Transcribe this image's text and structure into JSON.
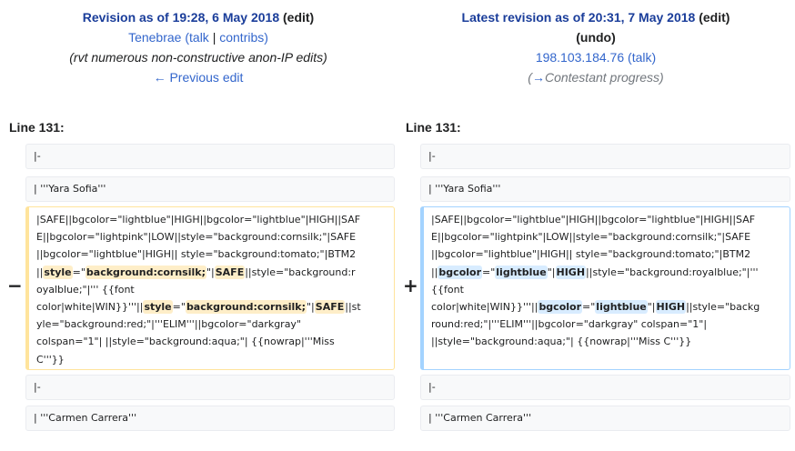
{
  "left": {
    "title": "Revision as of 19:28, 6 May 2018",
    "edit": "(edit)",
    "user": "Tenebrae",
    "talk": "talk",
    "contribs": "contribs",
    "summary": "(rvt numerous non-constructive anon-IP edits)",
    "nav": "← Previous edit",
    "line_no": "Line 131:",
    "marker": "−"
  },
  "right": {
    "title": "Latest revision as of 20:31, 7 May 2018",
    "edit": "(edit)",
    "undo": "(undo)",
    "user": "198.103.184.76",
    "talk": "talk",
    "summary_arrow": "→",
    "summary": "Contestant progress",
    "line_no": "Line 131:",
    "marker": "+"
  },
  "context": {
    "row1": "|-",
    "row2": "| '''Yara Sofia'''",
    "row3": "|-",
    "row4": "| '''Carmen Carrera'''"
  },
  "deleted_lines": [
    [
      {
        "t": "|SAFE||bgcolor=\"lightblue\"|HIGH||bgcolor=\"lightblue\"|HIGH||SAF",
        "h": false
      }
    ],
    [
      {
        "t": "E||bgcolor=\"lightpink\"|LOW||style=\"background:cornsilk;\"|SAFE",
        "h": false
      }
    ],
    [
      {
        "t": "||bgcolor=\"lightblue\"|HIGH|| style=\"background:tomato;\"|BTM2",
        "h": false
      }
    ],
    [
      {
        "t": "||",
        "h": false
      },
      {
        "t": "style",
        "h": true
      },
      {
        "t": "=\"",
        "h": false
      },
      {
        "t": "background:cornsilk;",
        "h": true
      },
      {
        "t": "\"|",
        "h": false
      },
      {
        "t": "SAFE",
        "h": true
      },
      {
        "t": "||style=\"background:r",
        "h": false
      }
    ],
    [
      {
        "t": "oyalblue;\"|''' {{font",
        "h": false
      }
    ],
    [
      {
        "t": "color|white|WIN}}'''||",
        "h": false
      },
      {
        "t": "style",
        "h": true
      },
      {
        "t": "=\"",
        "h": false
      },
      {
        "t": "background:cornsilk;",
        "h": true
      },
      {
        "t": "\"|",
        "h": false
      },
      {
        "t": "SAFE",
        "h": true
      },
      {
        "t": "||st",
        "h": false
      }
    ],
    [
      {
        "t": "yle=\"background:red;\"|'''ELIM'''||bgcolor=\"darkgray\"",
        "h": false
      }
    ],
    [
      {
        "t": "colspan=\"1\"| ||style=\"background:aqua;\"| {{nowrap|'''Miss",
        "h": false
      }
    ],
    [
      {
        "t": "C'''}}",
        "h": false
      }
    ]
  ],
  "added_lines": [
    [
      {
        "t": "|SAFE||bgcolor=\"lightblue\"|HIGH||bgcolor=\"lightblue\"|HIGH||SAF",
        "h": false
      }
    ],
    [
      {
        "t": "E||bgcolor=\"lightpink\"|LOW||style=\"background:cornsilk;\"|SAFE",
        "h": false
      }
    ],
    [
      {
        "t": "||bgcolor=\"lightblue\"|HIGH|| style=\"background:tomato;\"|BTM2",
        "h": false
      }
    ],
    [
      {
        "t": "||",
        "h": false
      },
      {
        "t": "bgcolor",
        "h": true
      },
      {
        "t": "=\"",
        "h": false
      },
      {
        "t": "lightblue",
        "h": true
      },
      {
        "t": "\"|",
        "h": false
      },
      {
        "t": "HIGH",
        "h": true
      },
      {
        "t": "||style=\"background:royalblue;\"|'''",
        "h": false
      }
    ],
    [
      {
        "t": "{{font",
        "h": false
      }
    ],
    [
      {
        "t": "color|white|WIN}}'''||",
        "h": false
      },
      {
        "t": "bgcolor",
        "h": true
      },
      {
        "t": "=\"",
        "h": false
      },
      {
        "t": "lightblue",
        "h": true
      },
      {
        "t": "\"|",
        "h": false
      },
      {
        "t": "HIGH",
        "h": true
      },
      {
        "t": "||style=\"backg",
        "h": false
      }
    ],
    [
      {
        "t": "round:red;\"|'''ELIM'''||bgcolor=\"darkgray\" colspan=\"1\"|",
        "h": false
      }
    ],
    [
      {
        "t": "||style=\"background:aqua;\"| {{nowrap|'''Miss C'''}}",
        "h": false
      }
    ]
  ],
  "colors": {
    "deleted_border": "#ffe49c",
    "added_border": "#a3d3ff",
    "link": "#3366cc"
  }
}
